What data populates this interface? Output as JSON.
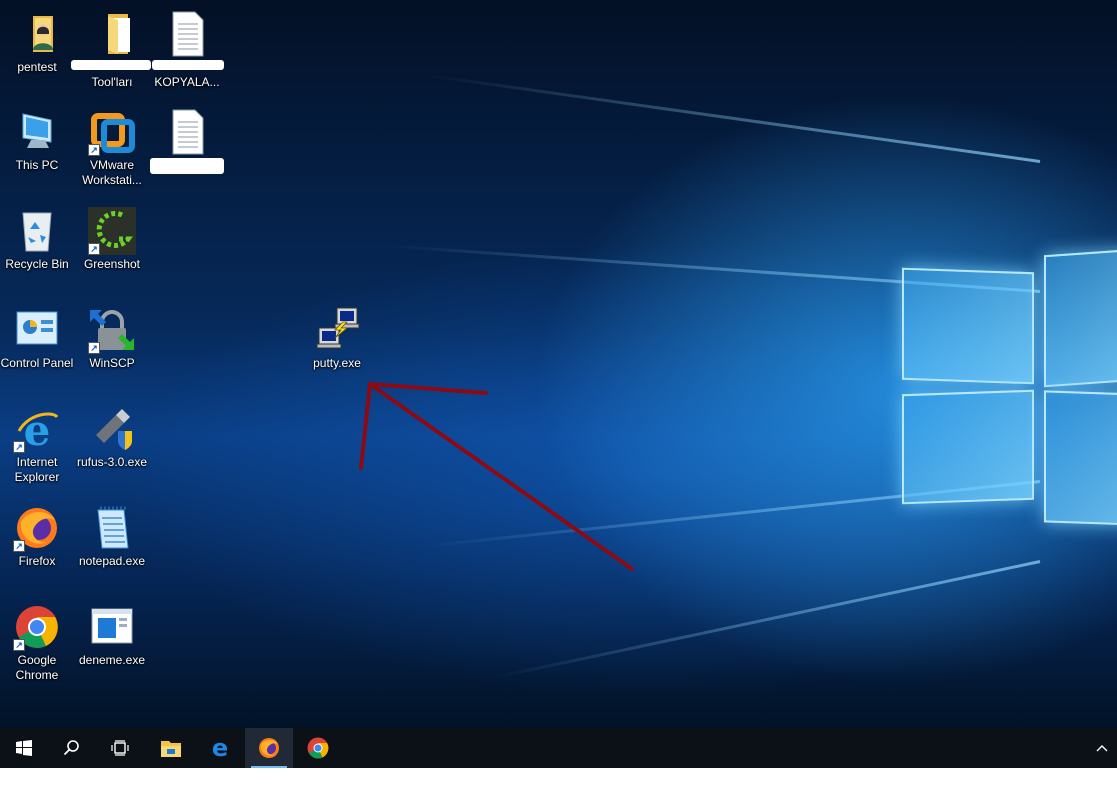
{
  "desktop": {
    "icons": {
      "pentest": {
        "label": "pentest",
        "icon": "user-folder-icon"
      },
      "tools_folder": {
        "label": "Tool'ları",
        "icon": "folder-icon"
      },
      "kopyala": {
        "label": "KOPYALA...",
        "icon": "text-document-icon"
      },
      "this_pc": {
        "label": "This PC",
        "icon": "computer-icon"
      },
      "vmware": {
        "label": "VMware Workstati...",
        "icon": "vmware-icon"
      },
      "doc2": {
        "label": "",
        "icon": "text-document-icon"
      },
      "recycle_bin": {
        "label": "Recycle Bin",
        "icon": "recycle-bin-icon"
      },
      "greenshot": {
        "label": "Greenshot",
        "icon": "greenshot-icon"
      },
      "control_panel": {
        "label": "Control Panel",
        "icon": "control-panel-icon"
      },
      "winscp": {
        "label": "WinSCP",
        "icon": "winscp-icon"
      },
      "putty": {
        "label": "putty.exe",
        "icon": "putty-icon"
      },
      "ie": {
        "label": "Internet Explorer",
        "icon": "internet-explorer-icon"
      },
      "rufus": {
        "label": "rufus-3.0.exe",
        "icon": "usb-drive-icon"
      },
      "firefox": {
        "label": "Firefox",
        "icon": "firefox-icon"
      },
      "notepad": {
        "label": "notepad.exe",
        "icon": "notepad-icon"
      },
      "chrome": {
        "label": "Google Chrome",
        "icon": "chrome-icon"
      },
      "deneme": {
        "label": "deneme.exe",
        "icon": "window-app-icon"
      }
    },
    "annotation": {
      "color": "#8b0a14",
      "icon": "red-arrow-annotation"
    }
  },
  "taskbar": {
    "start": "windows-start-icon",
    "search": "search-icon",
    "task_view": "task-view-icon",
    "pinned": [
      "file-explorer-icon",
      "edge-icon",
      "firefox-icon",
      "chrome-icon"
    ],
    "active_app": "firefox-icon",
    "tray": "chevron-up-icon"
  },
  "colors": {
    "taskbar": "#0c1118",
    "accent": "#76b9ed",
    "desktop": "#0a3e85"
  }
}
